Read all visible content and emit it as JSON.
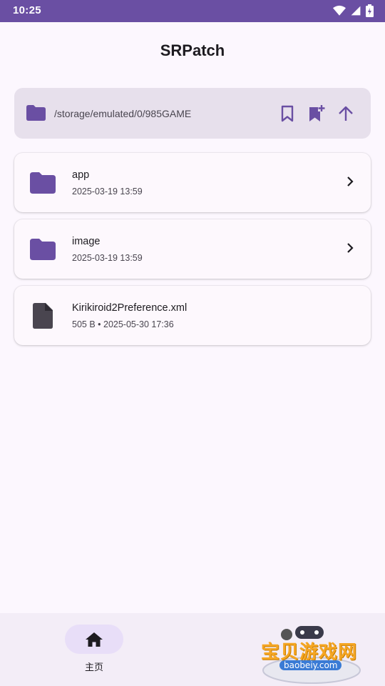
{
  "status_bar": {
    "time": "10:25"
  },
  "app": {
    "title": "SRPatch"
  },
  "path_bar": {
    "path": "/storage/emulated/0/985GAME"
  },
  "files": [
    {
      "name": "app",
      "meta": "2025-03-19 13:59",
      "type": "folder"
    },
    {
      "name": "image",
      "meta": "2025-03-19 13:59",
      "type": "folder"
    },
    {
      "name": "Kirikiroid2Preference.xml",
      "meta": "505 B • 2025-05-30 17:36",
      "type": "file"
    }
  ],
  "bottom_nav": {
    "home_label": "主页"
  },
  "watermark": {
    "text": "宝贝游戏网",
    "url": "baobeiy.com"
  },
  "colors": {
    "accent": "#6a4fa3",
    "surface": "#fcf7fe",
    "path_bar": "#e7e0ec",
    "nav_pill": "#e8def8"
  }
}
